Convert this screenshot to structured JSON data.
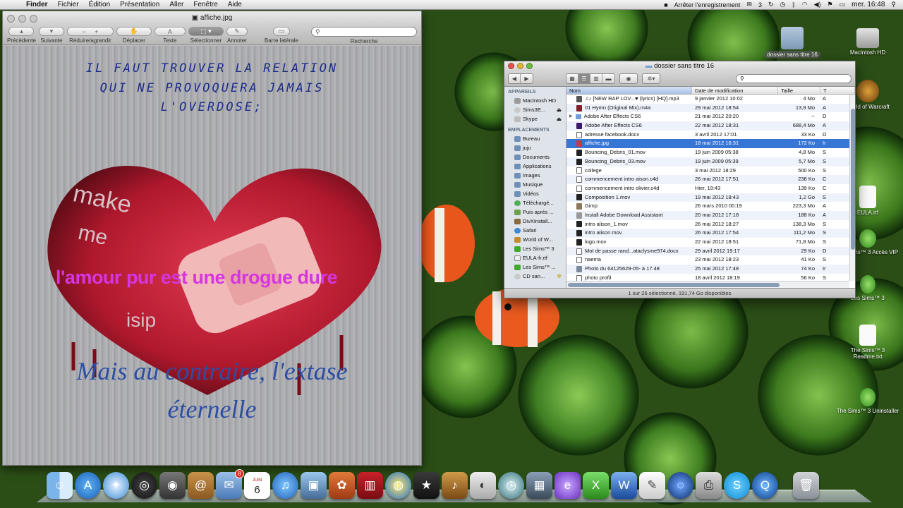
{
  "menubar": {
    "app": "Finder",
    "items": [
      "Fichier",
      "Édition",
      "Présentation",
      "Aller",
      "Fenêtre",
      "Aide"
    ],
    "recording": "Arrêter l'enregistrement",
    "badge": "3",
    "clock": "mer. 16:48"
  },
  "preview": {
    "title": "affiche.jpg",
    "toolbar": {
      "prev": "Précédente",
      "next": "Suivante",
      "zoom": "Réduire/agrandir",
      "move": "Déplacer",
      "text": "Texte",
      "select": "Sélectionner",
      "annotate": "Annoter",
      "sidebar": "Barre latérale",
      "search": "Recherche"
    },
    "image": {
      "line1": "IL FAUT TROUVER LA RELATION",
      "line2": "QUI NE PROVOQUERA JAMAIS",
      "line3": "L'OVERDOSE;",
      "heart_text1": "make",
      "heart_text2": "me",
      "heart_text3": "isip",
      "pink": "l'amour pur est une drogue dure",
      "blue1": "Mais au contraire, l'extase",
      "blue2": "éternelle"
    }
  },
  "finder": {
    "title": "dossier sans titre 16",
    "sidebar": {
      "devices_header": "APPAREILS",
      "devices": [
        "Macintosh HD",
        "Sims3E...",
        "Skype"
      ],
      "places_header": "EMPLACEMENTS",
      "places": [
        "Bureau",
        "juju",
        "Documents",
        "Applications",
        "Images",
        "Musique",
        "Vidéos",
        "Téléchargé...",
        "Puis après ...",
        "DivXInstall...",
        "Safari",
        "World of W...",
        "Les Sims™ 3",
        "EULA-fr.rtf",
        "Les Sims™ ...",
        "CD san..."
      ]
    },
    "columns": {
      "name": "Nom",
      "date": "Date de modification",
      "size": "Taille",
      "kind": "T"
    },
    "rows": [
      {
        "name": "♫♪ [NEW RAP LOV...♥ (lyrics) [HQ].mp3",
        "date": "9 janvier 2012 10:02",
        "size": "4 Mo",
        "kind": "A"
      },
      {
        "name": "01 Hymn (Original Mix).m4a",
        "date": "29 mai 2012 18:54",
        "size": "13,9 Mo",
        "kind": "A"
      },
      {
        "name": "Adobe After Effects CS6",
        "date": "21 mai 2012 20:20",
        "size": "--",
        "kind": "D"
      },
      {
        "name": "Adobe After Effects CS6",
        "date": "22 mai 2012 18:31",
        "size": "688,4 Mo",
        "kind": "A"
      },
      {
        "name": "adresse facebook.docx",
        "date": "3 avril 2012 17:01",
        "size": "33 Ko",
        "kind": "D"
      },
      {
        "name": "affiche.jpg",
        "date": "18 mai 2012 16:31",
        "size": "172 Ko",
        "kind": "Ir"
      },
      {
        "name": "Bouncing_Debris_01.mov",
        "date": "19 juin 2009 05:38",
        "size": "4,8 Mo",
        "kind": "S"
      },
      {
        "name": "Bouncing_Debris_03.mov",
        "date": "19 juin 2009 05:39",
        "size": "5,7 Mo",
        "kind": "S"
      },
      {
        "name": "college",
        "date": "3 mai 2012 18:29",
        "size": "500 Ko",
        "kind": "S"
      },
      {
        "name": "commencement intro aison.c4d",
        "date": "26 mai 2012 17:51",
        "size": "238 Ko",
        "kind": "C"
      },
      {
        "name": "commencement intro olivier.c4d",
        "date": "Hier, 19:43",
        "size": "139 Ko",
        "kind": "C"
      },
      {
        "name": "Composition 1.mov",
        "date": "19 mai 2012 18:43",
        "size": "1,2 Go",
        "kind": "S"
      },
      {
        "name": "Gimp",
        "date": "26 mars 2010 00:19",
        "size": "223,3 Mo",
        "kind": "A"
      },
      {
        "name": "Install Adobe Download Assistant",
        "date": "20 mai 2012 17:18",
        "size": "188 Ko",
        "kind": "A"
      },
      {
        "name": "intro alison_1.mov",
        "date": "26 mai 2012 18:27",
        "size": "138,3 Mo",
        "kind": "S"
      },
      {
        "name": "intro alison.mov",
        "date": "26 mai 2012 17:54",
        "size": "111,2 Mo",
        "kind": "S"
      },
      {
        "name": "logo.mov",
        "date": "22 mai 2012 18:51",
        "size": "71,8 Mo",
        "kind": "S"
      },
      {
        "name": "Mot de passe rand...ataclysme974.docx",
        "date": "29 avril 2012 19:17",
        "size": "29 Ko",
        "kind": "D"
      },
      {
        "name": "naema",
        "date": "23 mai 2012 18:23",
        "size": "41 Ko",
        "kind": "S"
      },
      {
        "name": "Photo du 64125629-05- à 17.48",
        "date": "25 mai 2012 17:48",
        "size": "74 Ko",
        "kind": "Ir"
      },
      {
        "name": "photo profil",
        "date": "18 avril 2012 18:19",
        "size": "56 Ko",
        "kind": "S"
      }
    ],
    "status": "1 sur 26 sélectionné, 191,74 Go disponibles"
  },
  "desktop": {
    "folder": "dossier sans titre 16",
    "hd": "Macintosh HD",
    "wow": "World of Warcraft",
    "eula": "EULA.rtf",
    "sims_vip": "Les Sims™ 3 Accès VIP",
    "sims3": "Les Sims™ 3",
    "readme": "The Sims™ 3 Readme.txt",
    "uninstall": "The Sims™ 3 Uninstaller"
  },
  "dock": {
    "calendar_day": "6",
    "calendar_month": "JUIN",
    "mail_badge": "8"
  },
  "colors": {
    "selection": "#3876d6",
    "pink_text": "#d536e0",
    "blue_text": "#2b4ea4",
    "navy_text": "#1b2b8a"
  }
}
